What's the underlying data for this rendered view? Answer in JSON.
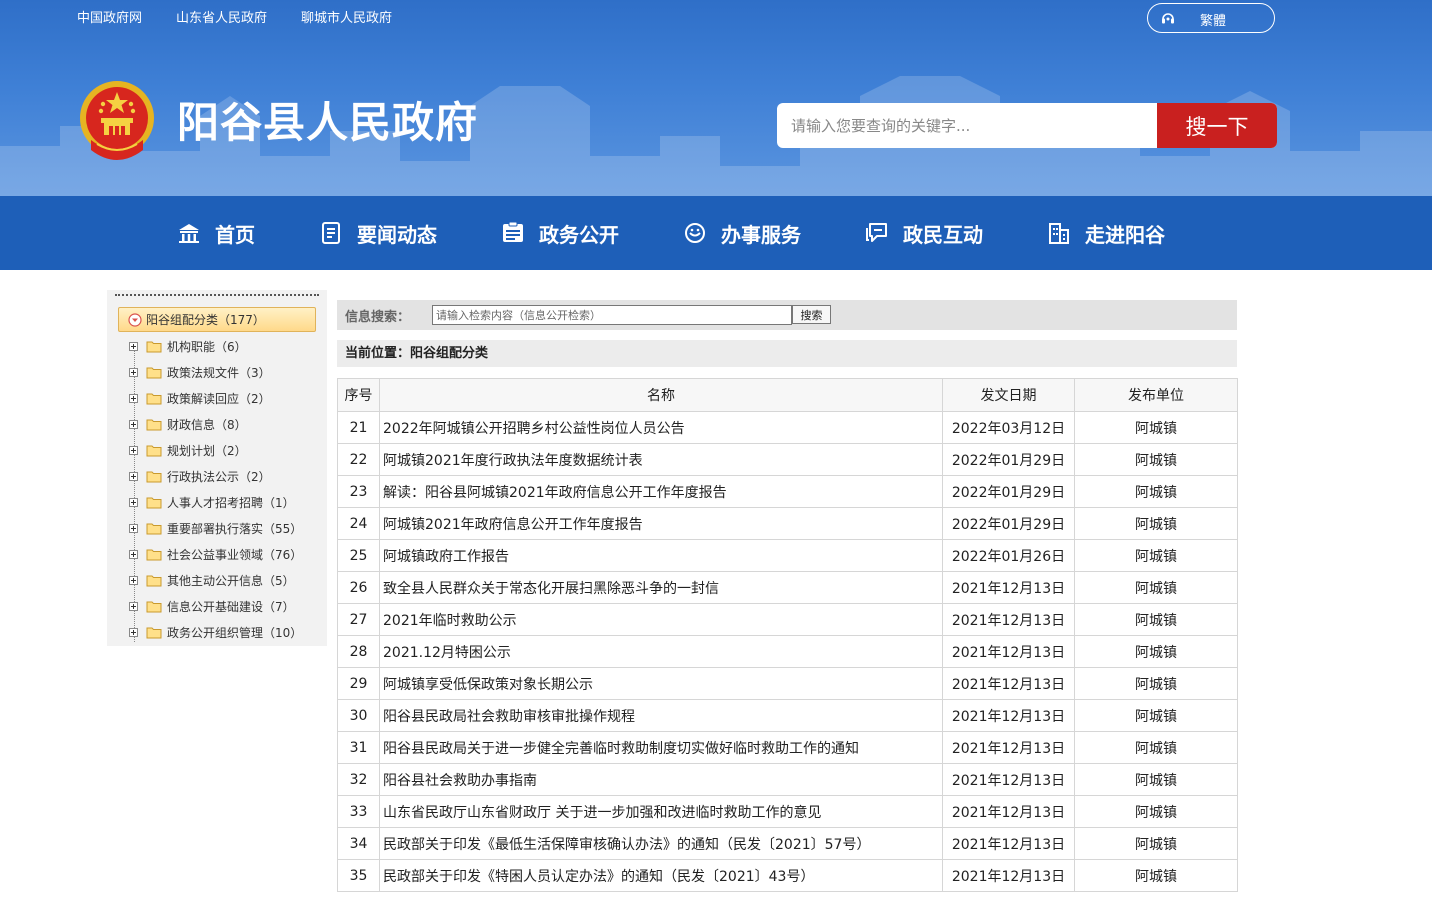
{
  "topbar": {
    "links": [
      "中国政府网",
      "山东省人民政府",
      "聊城市人民政府"
    ],
    "lang_toggle": "繁體"
  },
  "header": {
    "site_title": "阳谷县人民政府",
    "search_placeholder": "请输入您要查询的关键字...",
    "search_button": "搜一下"
  },
  "nav": {
    "items": [
      {
        "label": "首页",
        "icon": "building-icon"
      },
      {
        "label": "要闻动态",
        "icon": "document-icon"
      },
      {
        "label": "政务公开",
        "icon": "notice-icon"
      },
      {
        "label": "办事服务",
        "icon": "service-icon"
      },
      {
        "label": "政民互动",
        "icon": "chat-icon"
      },
      {
        "label": "走进阳谷",
        "icon": "city-icon"
      }
    ]
  },
  "sidebar": {
    "root": "阳谷组配分类（177）",
    "items": [
      "机构职能（6）",
      "政策法规文件（3）",
      "政策解读回应（2）",
      "财政信息（8）",
      "规划计划（2）",
      "行政执法公示（2）",
      "人事人才招考招聘（1）",
      "重要部署执行落实（55）",
      "社会公益事业领域（76）",
      "其他主动公开信息（5）",
      "信息公开基础建设（7）",
      "政务公开组织管理（10）"
    ]
  },
  "info_search": {
    "label": "信息搜索：",
    "placeholder": "请输入检索内容（信息公开检索）",
    "button": "搜索"
  },
  "breadcrumb": "当前位置：阳谷组配分类",
  "table": {
    "headers": [
      "序号",
      "名称",
      "发文日期",
      "发布单位"
    ],
    "rows": [
      {
        "num": "21",
        "title": "2022年阿城镇公开招聘乡村公益性岗位人员公告",
        "date": "2022年03月12日",
        "unit": "阿城镇"
      },
      {
        "num": "22",
        "title": "阿城镇2021年度行政执法年度数据统计表",
        "date": "2022年01月29日",
        "unit": "阿城镇"
      },
      {
        "num": "23",
        "title": "解读：阳谷县阿城镇2021年政府信息公开工作年度报告",
        "date": "2022年01月29日",
        "unit": "阿城镇"
      },
      {
        "num": "24",
        "title": "阿城镇2021年政府信息公开工作年度报告",
        "date": "2022年01月29日",
        "unit": "阿城镇"
      },
      {
        "num": "25",
        "title": "阿城镇政府工作报告",
        "date": "2022年01月26日",
        "unit": "阿城镇"
      },
      {
        "num": "26",
        "title": "致全县人民群众关于常态化开展扫黑除恶斗争的一封信",
        "date": "2021年12月13日",
        "unit": "阿城镇"
      },
      {
        "num": "27",
        "title": "2021年临时救助公示",
        "date": "2021年12月13日",
        "unit": "阿城镇"
      },
      {
        "num": "28",
        "title": "2021.12月特困公示",
        "date": "2021年12月13日",
        "unit": "阿城镇"
      },
      {
        "num": "29",
        "title": "阿城镇享受低保政策对象长期公示",
        "date": "2021年12月13日",
        "unit": "阿城镇"
      },
      {
        "num": "30",
        "title": "阳谷县民政局社会救助审核审批操作规程",
        "date": "2021年12月13日",
        "unit": "阿城镇"
      },
      {
        "num": "31",
        "title": "阳谷县民政局关于进一步健全完善临时救助制度切实做好临时救助工作的通知",
        "date": "2021年12月13日",
        "unit": "阿城镇"
      },
      {
        "num": "32",
        "title": "阳谷县社会救助办事指南",
        "date": "2021年12月13日",
        "unit": "阿城镇"
      },
      {
        "num": "33",
        "title": "山东省民政厅山东省财政厅 关于进一步加强和改进临时救助工作的意见",
        "date": "2021年12月13日",
        "unit": "阿城镇"
      },
      {
        "num": "34",
        "title": "民政部关于印发《最低生活保障审核确认办法》的通知（民发〔2021〕57号）",
        "date": "2021年12月13日",
        "unit": "阿城镇"
      },
      {
        "num": "35",
        "title": "民政部关于印发《特困人员认定办法》的通知（民发〔2021〕43号）",
        "date": "2021年12月13日",
        "unit": "阿城镇"
      }
    ]
  },
  "colors": {
    "header_blue": "#3a7bd3",
    "nav_blue": "#1e5fb8",
    "search_red": "#c9201f"
  }
}
